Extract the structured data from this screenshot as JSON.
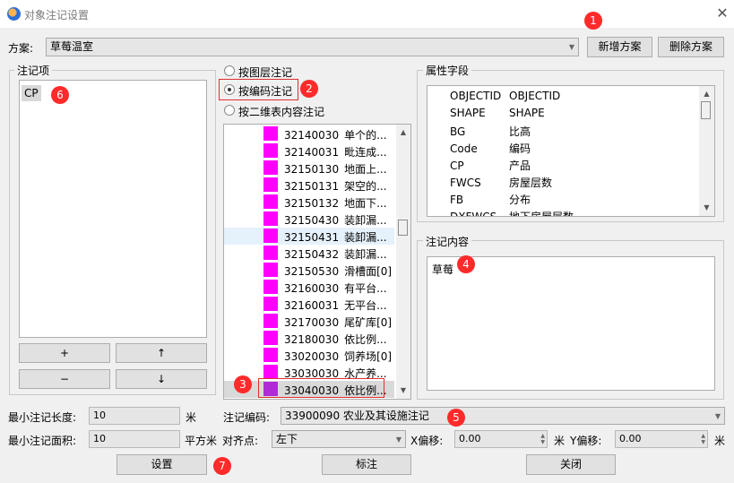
{
  "window": {
    "title": "对象注记设置",
    "close_glyph": "✕"
  },
  "scheme": {
    "label": "方案:",
    "value": "草莓温室",
    "add_button": "新增方案",
    "delete_button": "删除方案"
  },
  "annotation_items": {
    "title": "注记项",
    "items": [
      "CP"
    ],
    "buttons": {
      "add": "+",
      "up": "↑",
      "remove": "−",
      "down": "↓"
    }
  },
  "modes": [
    {
      "label": "按图层注记",
      "selected": false
    },
    {
      "label": "按编码注记",
      "selected": true
    },
    {
      "label": "按二维表内容注记",
      "selected": false
    }
  ],
  "code_list": [
    {
      "code": "32140030",
      "name": "单个的...",
      "color": "#ff00ff"
    },
    {
      "code": "32140031",
      "name": "毗连成...",
      "color": "#ff00ff"
    },
    {
      "code": "32150130",
      "name": "地面上...",
      "color": "#ff00ff"
    },
    {
      "code": "32150131",
      "name": "架空的...",
      "color": "#ff00ff"
    },
    {
      "code": "32150132",
      "name": "地面下...",
      "color": "#ff00ff"
    },
    {
      "code": "32150430",
      "name": "装卸漏...",
      "color": "#ff00ff"
    },
    {
      "code": "32150431",
      "name": "装卸漏...",
      "color": "#ff00ff"
    },
    {
      "code": "32150432",
      "name": "装卸漏...",
      "color": "#ff00ff"
    },
    {
      "code": "32150530",
      "name": "滑槽面[0]",
      "color": "#ff00ff"
    },
    {
      "code": "32160030",
      "name": "有平台...",
      "color": "#ff00ff"
    },
    {
      "code": "32160031",
      "name": "无平台...",
      "color": "#ff00ff"
    },
    {
      "code": "32170030",
      "name": "尾矿库[0]",
      "color": "#ff00ff"
    },
    {
      "code": "32180030",
      "name": "依比例...",
      "color": "#ff00ff"
    },
    {
      "code": "33020030",
      "name": "饲养场[0]",
      "color": "#ff00ff"
    },
    {
      "code": "33030030",
      "name": "水产养...",
      "color": "#ff00ff"
    },
    {
      "code": "33040030",
      "name": "依比例...",
      "color": "#b02bd6"
    }
  ],
  "attribute_fields": {
    "title": "属性字段",
    "rows": [
      {
        "name": "OBJECTID",
        "alias": "OBJECTID"
      },
      {
        "name": "SHAPE",
        "alias": "SHAPE"
      },
      {
        "name": "BG",
        "alias": "比高"
      },
      {
        "name": "Code",
        "alias": "编码"
      },
      {
        "name": "CP",
        "alias": "产品"
      },
      {
        "name": "FWCS",
        "alias": "房屋层数"
      },
      {
        "name": "FB",
        "alias": "分布"
      },
      {
        "name": "DXFWCS",
        "alias": "地下房屋层数"
      }
    ]
  },
  "annotation_content": {
    "title": "注记内容",
    "value": "草莓"
  },
  "bottom": {
    "min_length_label": "最小注记长度:",
    "min_length_value": "10",
    "min_length_unit": "米",
    "min_area_label": "最小注记面积:",
    "min_area_value": "10",
    "min_area_unit": "平方米",
    "code_label": "注记编码:",
    "code_value": "33900090 农业及其设施注记",
    "align_label": "对齐点:",
    "align_value": "左下",
    "x_offset_label": "X偏移:",
    "x_offset_value": "0.00",
    "x_offset_unit": "米",
    "y_offset_label": "Y偏移:",
    "y_offset_value": "0.00",
    "y_offset_unit": "米"
  },
  "actions": {
    "set": "设置",
    "annotate": "标注",
    "close": "关闭"
  },
  "markers": [
    "1",
    "2",
    "3",
    "4",
    "5",
    "6",
    "7"
  ],
  "colors": {
    "marker": "#ff2a2a",
    "swatch": "#ff00ff",
    "selected_swatch": "#b02bd6",
    "selection_bg": "#e5f1fb"
  }
}
